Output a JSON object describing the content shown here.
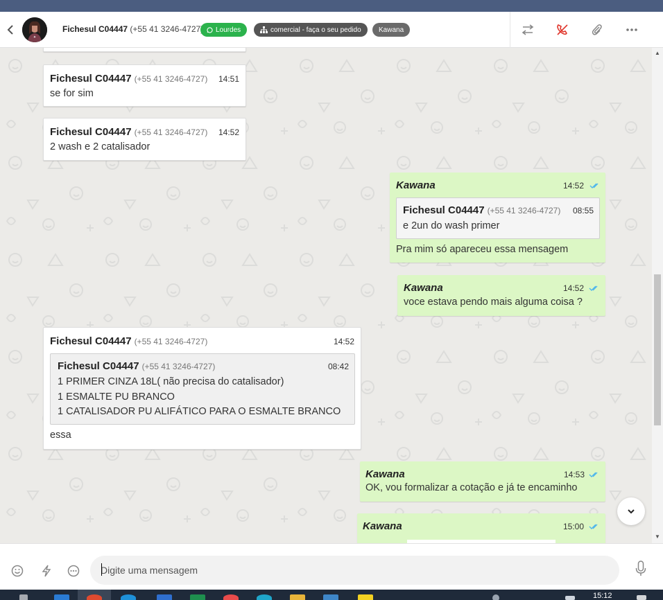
{
  "header": {
    "contact_name": "Fichesul C04447",
    "contact_phone": "(+55 41 3246-4727)",
    "agent_tag": "Lourdes",
    "department_tag": "comercial - faça o seu pedido",
    "user_tag": "Kawana",
    "icons": [
      "back-arrow-icon",
      "transfer-icon",
      "end-call-icon",
      "attach-icon",
      "more-icon"
    ]
  },
  "messages": [
    {
      "sender": "Fichesul C04447",
      "phone": "(+55 41 3246-4727)",
      "time": "14:51",
      "text": "se for sim"
    },
    {
      "sender": "Fichesul C04447",
      "phone": "(+55 41 3246-4727)",
      "time": "14:52",
      "text": "2 wash e 2 catalisador"
    },
    {
      "sender": "Kawana",
      "time": "14:52",
      "quote": {
        "sender": "Fichesul C04447",
        "phone": "(+55 41 3246-4727)",
        "time": "08:55",
        "text": "e 2un do wash primer"
      },
      "text": "Pra mim só apareceu essa mensagem"
    },
    {
      "sender": "Kawana",
      "time": "14:52",
      "text": "voce estava pendo mais alguma coisa ?"
    },
    {
      "sender": "Fichesul C04447",
      "phone": "(+55 41 3246-4727)",
      "time": "14:52",
      "quote": {
        "sender": "Fichesul C04447",
        "phone": "(+55 41 3246-4727)",
        "time": "08:42",
        "lines": [
          "1 PRIMER CINZA 18L( não precisa do catalisador)",
          "1 ESMALTE PU BRANCO",
          "1 CATALISADOR PU ALIFÁTICO PARA O ESMALTE BRANCO"
        ]
      },
      "text": "essa"
    },
    {
      "sender": "Kawana",
      "time": "14:53",
      "text": "OK, vou formalizar a cotação e já te encaminho"
    },
    {
      "sender": "Kawana",
      "time": "15:00"
    }
  ],
  "composer": {
    "placeholder": "Digite uma mensagem",
    "icons": [
      "emoji-icon",
      "quick-reply-icon",
      "more-options-icon",
      "microphone-icon"
    ]
  },
  "taskbar": {
    "clock": "15:12"
  },
  "colors": {
    "outgoing_bubble": "#dcf7c5",
    "incoming_bubble": "#ffffff",
    "agent_tag": "#2bb24c",
    "read_ticks": "#4fb6ec",
    "end_call": "#e0352b"
  }
}
